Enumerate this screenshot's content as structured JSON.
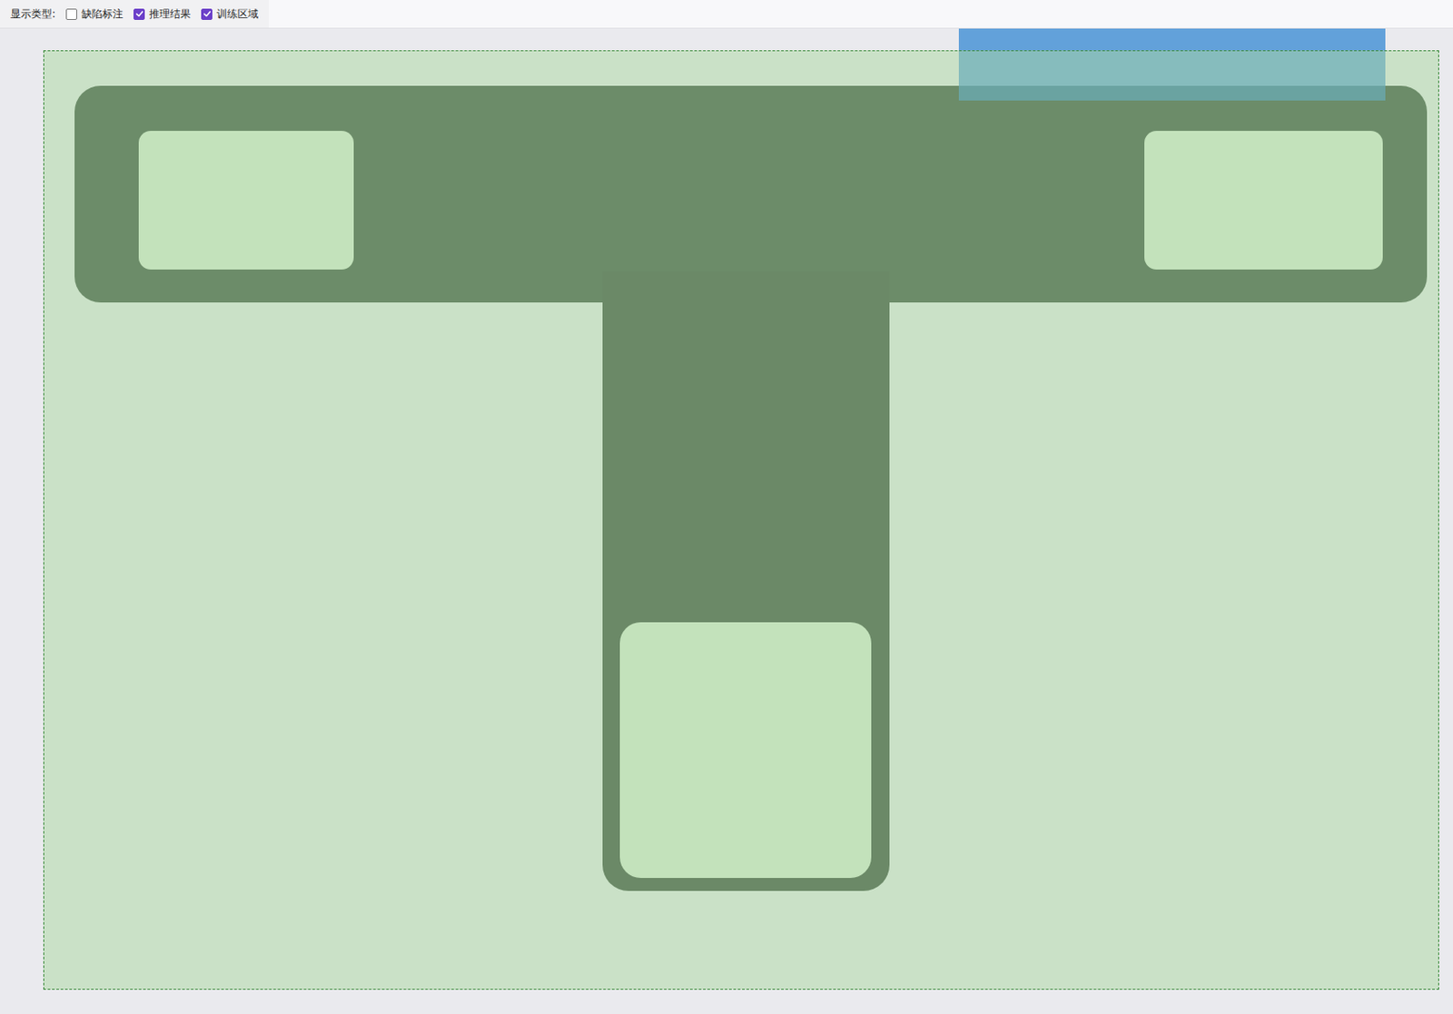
{
  "toolbar": {
    "label": "显示类型:",
    "options": [
      {
        "label": "缺陷标注",
        "checked": false
      },
      {
        "label": "推理结果",
        "checked": true
      },
      {
        "label": "训练区域",
        "checked": true
      }
    ]
  }
}
